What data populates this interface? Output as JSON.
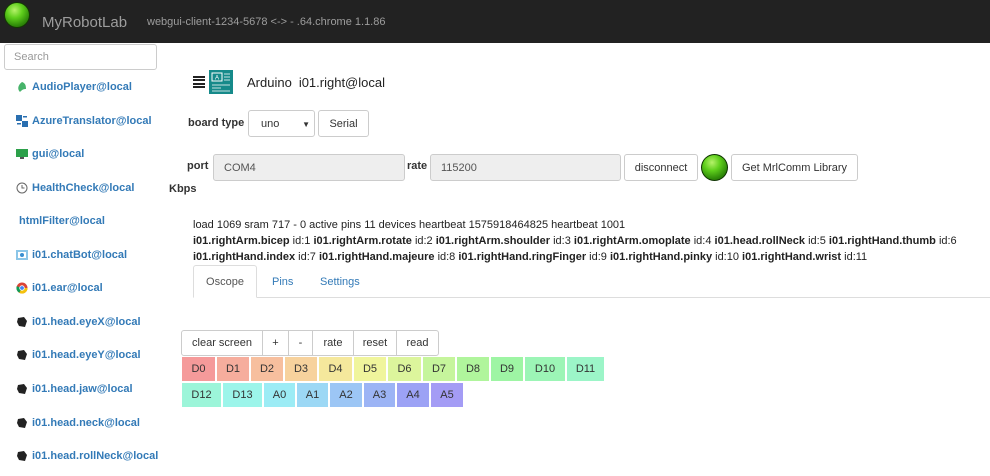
{
  "navbar": {
    "title": "MyRobotLab",
    "client": "webgui-client-1234-5678 <-> - .64.chrome 1.1.86"
  },
  "sidebar": {
    "search_placeholder": "Search",
    "items": [
      {
        "label": "AudioPlayer@local",
        "icon": "audio-icon"
      },
      {
        "label": "AzureTranslator@local",
        "icon": "translator-icon"
      },
      {
        "label": "gui@local",
        "icon": "monitor-icon"
      },
      {
        "label": "HealthCheck@local",
        "icon": "clock-icon"
      },
      {
        "label": "htmlFilter@local",
        "icon": ""
      },
      {
        "label": "i01.chatBot@local",
        "icon": "chatbot-icon"
      },
      {
        "label": "i01.ear@local",
        "icon": "chrome-icon"
      },
      {
        "label": "i01.head.eyeX@local",
        "icon": "servo-icon"
      },
      {
        "label": "i01.head.eyeY@local",
        "icon": "servo-icon"
      },
      {
        "label": "i01.head.jaw@local",
        "icon": "servo-icon"
      },
      {
        "label": "i01.head.neck@local",
        "icon": "servo-icon"
      },
      {
        "label": "i01.head.rollNeck@local",
        "icon": "servo-icon"
      }
    ]
  },
  "service": {
    "type": "Arduino",
    "name": "i01.right@local"
  },
  "board": {
    "label": "board type",
    "selected": "uno",
    "serial_button": "Serial"
  },
  "connection": {
    "port_label": "port",
    "port_value": "COM4",
    "rate_label": "rate",
    "rate_value": "115200",
    "disconnect_button": "disconnect",
    "library_button": "Get MrlComm Library",
    "kbps_label": "Kbps",
    "status_color": "#3cb01a"
  },
  "info": {
    "status_line": "load 1069 sram 717 - 0 active pins 11 devices heartbeat 1575918464825 heartbeat 1001",
    "devices": [
      {
        "name": "i01.rightArm.bicep",
        "id": "id:1"
      },
      {
        "name": "i01.rightArm.rotate",
        "id": "id:2"
      },
      {
        "name": "i01.rightArm.shoulder",
        "id": "id:3"
      },
      {
        "name": "i01.rightArm.omoplate",
        "id": "id:4"
      },
      {
        "name": "i01.head.rollNeck",
        "id": "id:5"
      },
      {
        "name": "i01.rightHand.thumb",
        "id": "id:6"
      },
      {
        "name": "i01.rightHand.index",
        "id": "id:7"
      },
      {
        "name": "i01.rightHand.majeure",
        "id": "id:8"
      },
      {
        "name": "i01.rightHand.ringFinger",
        "id": "id:9"
      },
      {
        "name": "i01.rightHand.pinky",
        "id": "id:10"
      },
      {
        "name": "i01.rightHand.wrist",
        "id": "id:11"
      }
    ]
  },
  "tabs": [
    {
      "label": "Oscope",
      "active": true
    },
    {
      "label": "Pins",
      "active": false
    },
    {
      "label": "Settings",
      "active": false
    }
  ],
  "oscope": {
    "buttons": [
      "clear screen",
      "+",
      "-",
      "rate",
      "reset",
      "read"
    ],
    "pins": [
      {
        "label": "D0",
        "color": "#f59a9a"
      },
      {
        "label": "D1",
        "color": "#f6ad9d"
      },
      {
        "label": "D2",
        "color": "#f7bf9e"
      },
      {
        "label": "D3",
        "color": "#f7d29d"
      },
      {
        "label": "D4",
        "color": "#f5e89c"
      },
      {
        "label": "D5",
        "color": "#f0f59c"
      },
      {
        "label": "D6",
        "color": "#dcf59c"
      },
      {
        "label": "D7",
        "color": "#c6f59c"
      },
      {
        "label": "D8",
        "color": "#b0f59c"
      },
      {
        "label": "D9",
        "color": "#9ef5a4"
      },
      {
        "label": "D10",
        "color": "#9cf5b6"
      },
      {
        "label": "D11",
        "color": "#9cf5c8"
      },
      {
        "label": "D12",
        "color": "#9cf5d9"
      },
      {
        "label": "D13",
        "color": "#9cf5ea"
      },
      {
        "label": "A0",
        "color": "#9cecf5"
      },
      {
        "label": "A1",
        "color": "#9cd8f5"
      },
      {
        "label": "A2",
        "color": "#9cc6f5"
      },
      {
        "label": "A3",
        "color": "#9cb4f5"
      },
      {
        "label": "A4",
        "color": "#9ca2f5"
      },
      {
        "label": "A5",
        "color": "#a49cf5"
      }
    ]
  }
}
